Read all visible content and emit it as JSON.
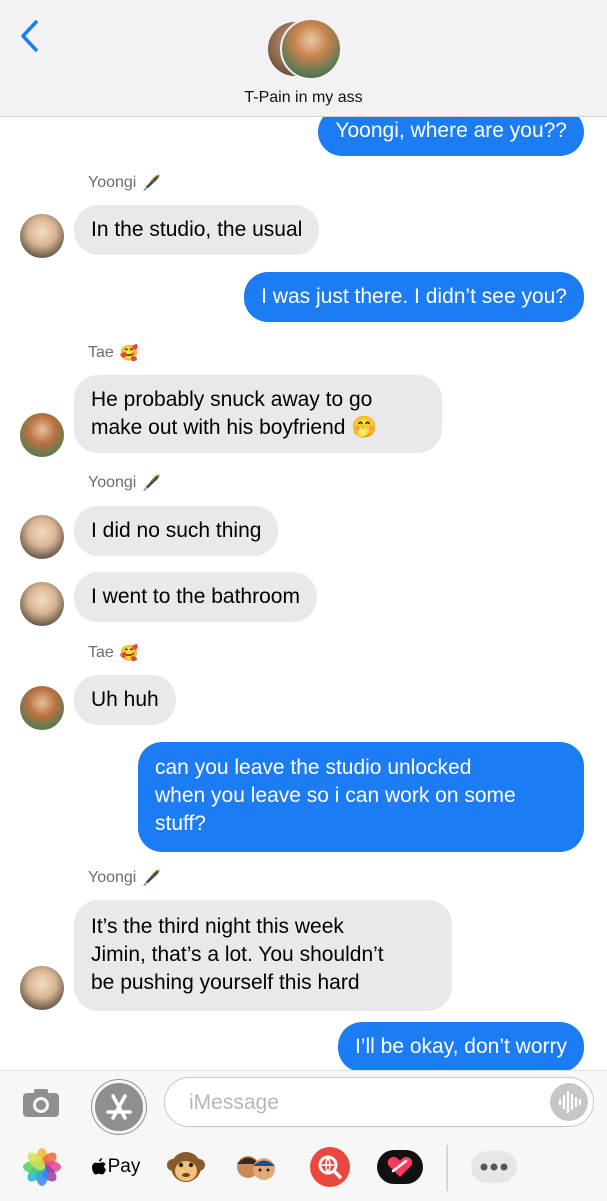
{
  "header": {
    "back_icon": "chevron-left-icon",
    "group_name": "T-Pain in my ass",
    "accent": "#1c7cf4"
  },
  "messages": [
    {
      "direction": "outgoing",
      "text": "Yoongi, where are you??"
    },
    {
      "sender": "Yoongi",
      "sender_emoji": "🖋️",
      "direction": "incoming",
      "text": "In the studio, the usual"
    },
    {
      "direction": "outgoing",
      "text": "I was just there. I didn’t see you?"
    },
    {
      "sender": "Tae",
      "sender_emoji": "🥰",
      "direction": "incoming",
      "text_line1": "He probably snuck away to go",
      "text_line2": "make out with his boyfriend 🤭"
    },
    {
      "sender": "Yoongi",
      "sender_emoji": "🖋️",
      "direction": "incoming",
      "text": "I did no such thing"
    },
    {
      "direction": "incoming",
      "text": "I went to the bathroom"
    },
    {
      "sender": "Tae",
      "sender_emoji": "🥰",
      "direction": "incoming",
      "text": "Uh huh"
    },
    {
      "direction": "outgoing",
      "text_line1": "can you leave the studio unlocked",
      "text_line2": "when you leave so i can work on some",
      "text_line3": "stuff?"
    },
    {
      "sender": "Yoongi",
      "sender_emoji": "🖋️",
      "direction": "incoming",
      "text_line1": "It’s the third night this week",
      "text_line2": "Jimin, that’s a lot. You shouldn’t",
      "text_line3": "be pushing yourself this hard"
    },
    {
      "direction": "outgoing",
      "text": "I’ll be okay, don’t worry"
    }
  ],
  "composer": {
    "placeholder": "iMessage",
    "camera_icon": "camera-icon",
    "apps_icon": "app-store-icon",
    "audio_icon": "waveform-icon"
  },
  "app_drawer": {
    "apple_pay_label": "Pay",
    "items": [
      "photos-icon",
      "apple-pay-icon",
      "monkey-emoji-icon",
      "memoji-icon",
      "web-search-icon",
      "heart-sticker-icon",
      "more-icon"
    ]
  }
}
